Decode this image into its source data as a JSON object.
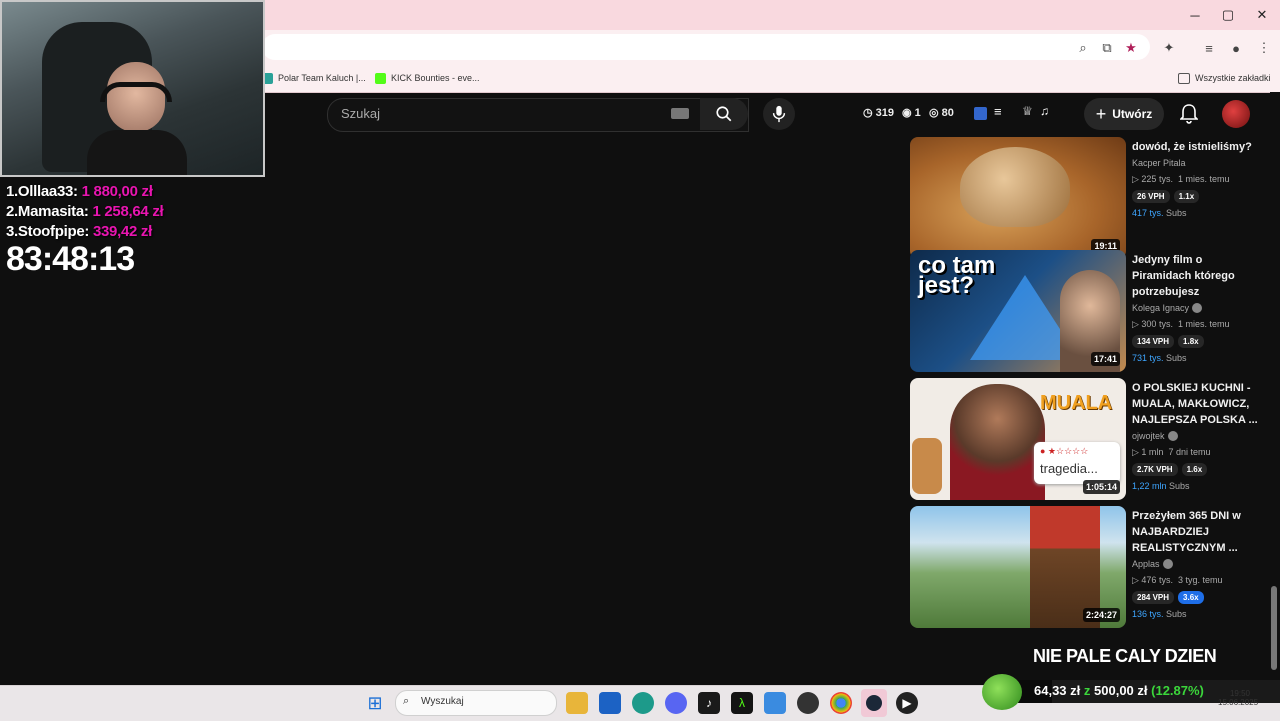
{
  "browser": {
    "bookmarks": [
      {
        "label": "Polar Team Kaluch |..."
      },
      {
        "label": "KICK Bounties - eve..."
      }
    ],
    "all_bookmarks_label": "Wszystkie zakładki",
    "window_controls": {
      "minimize": "─",
      "maximize": "▢",
      "close": "✕"
    }
  },
  "youtube": {
    "search_placeholder": "Szukaj",
    "stats": [
      {
        "icon": "clock-icon",
        "glyph": "◷",
        "value": "319"
      },
      {
        "icon": "eye-icon",
        "glyph": "◉",
        "value": "1"
      },
      {
        "icon": "eye-icon",
        "glyph": "◎",
        "value": "80"
      }
    ],
    "create_label": "Utwórz",
    "videos": [
      {
        "title": "dowód, że istnieliśmy?",
        "channel": "Kacper Pitala",
        "verified": false,
        "views": "225 tys.",
        "age": "1 mies. temu",
        "vph": "26 VPH",
        "ratio": "1.1x",
        "ratio_highlight": false,
        "subs_num": "417 tys.",
        "subs_label": "Subs",
        "duration": "19:11"
      },
      {
        "title": "Jedyny film o Piramidach którego potrzebujesz",
        "channel": "Kolega Ignacy",
        "verified": true,
        "views": "300 tys.",
        "age": "1 mies. temu",
        "vph": "134 VPH",
        "ratio": "1.8x",
        "ratio_highlight": false,
        "subs_num": "731 tys.",
        "subs_label": "Subs",
        "duration": "17:41",
        "thumb_text": "co tam jest?"
      },
      {
        "title": "O POLSKIEJ KUCHNI - MUALA, MAKŁOWICZ, NAJLEPSZA POLSKA ...",
        "channel": "ojwojtek",
        "verified": true,
        "views": "1 mln",
        "age": "7 dni temu",
        "vph": "2.7K VPH",
        "ratio": "1.6x",
        "ratio_highlight": false,
        "subs_num": "1,22 mln",
        "subs_label": "Subs",
        "duration": "1:05:14",
        "thumb_text": "MUALA",
        "thumb_text2": "tragedia..."
      },
      {
        "title": "Przeżyłem 365 DNI w NAJBARDZIEJ REALISTYCZNYM ...",
        "channel": "Applas",
        "verified": true,
        "views": "476 tys.",
        "age": "3 tyg. temu",
        "vph": "284 VPH",
        "ratio": "3.6x",
        "ratio_highlight": true,
        "subs_num": "136 tys.",
        "subs_label": "Subs",
        "duration": "2:24:27"
      }
    ]
  },
  "overlay": {
    "leaderboard": [
      {
        "rank": "1.",
        "name": "Olllaa33:",
        "amount": "1 880,00 zł"
      },
      {
        "rank": "2.",
        "name": "Mamasita:",
        "amount": "1 258,64 zł"
      },
      {
        "rank": "3.",
        "name": "Stoofpipe:",
        "amount": "339,42 zł"
      }
    ],
    "timer": "83:48:13",
    "banner": "NIE PALE CALY DZIEN",
    "goal": {
      "current": "64,33 zł",
      "sep": "z",
      "target": "500,00 zł",
      "percent": "(12.87%)",
      "fraction": 0.1287
    }
  },
  "taskbar": {
    "search_placeholder": "Wyszukaj",
    "clock_time": "19:50",
    "clock_date": "15.06.2025"
  },
  "colors": {
    "accent_pink": "#e815b0",
    "link_blue": "#3ea6ff",
    "goal_green": "#3bd63b"
  }
}
